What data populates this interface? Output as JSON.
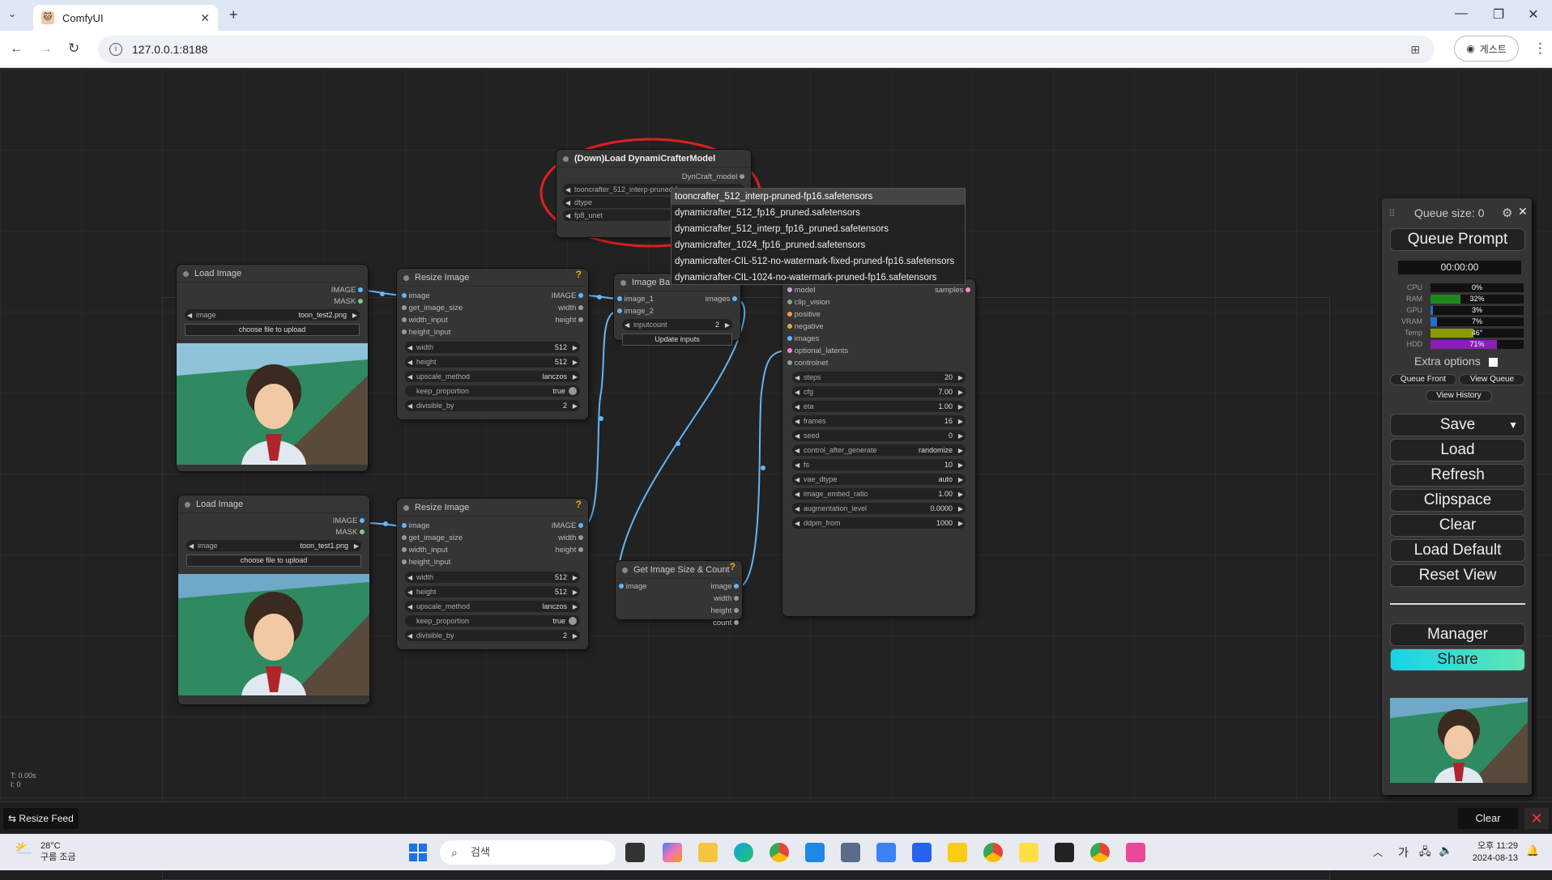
{
  "browser": {
    "tab_title": "ComfyUI",
    "url": "127.0.0.1:8188",
    "profile_label": "게스트"
  },
  "nodes": {
    "dyn_loader": {
      "title": "(Down)Load DynamiCrafterModel",
      "output": "DynCraft_model",
      "model_value": "tooncrafter_512_interp-pruned-f",
      "dtype_label": "dtype",
      "fp8_label": "fp8_unet"
    },
    "load_image_1": {
      "title": "Load Image",
      "out_image": "IMAGE",
      "out_mask": "MASK",
      "widget_label": "image",
      "widget_value": "toon_test2.png",
      "upload": "choose file to upload"
    },
    "load_image_2": {
      "title": "Load Image",
      "out_image": "IMAGE",
      "out_mask": "MASK",
      "widget_label": "image",
      "widget_value": "toon_test1.png",
      "upload": "choose file to upload"
    },
    "resize_1": {
      "title": "Resize Image",
      "inputs": [
        "image",
        "get_image_size",
        "width_input",
        "height_input"
      ],
      "outputs": [
        "IMAGE",
        "width",
        "height"
      ],
      "widgets": [
        {
          "label": "width",
          "value": "512"
        },
        {
          "label": "height",
          "value": "512"
        },
        {
          "label": "upscale_method",
          "value": "lanczos"
        },
        {
          "label": "keep_proportion",
          "value": "true"
        },
        {
          "label": "divisible_by",
          "value": "2"
        }
      ]
    },
    "resize_2": {
      "title": "Resize Image",
      "inputs": [
        "image",
        "get_image_size",
        "width_input",
        "height_input"
      ],
      "outputs": [
        "IMAGE",
        "width",
        "height"
      ],
      "widgets": [
        {
          "label": "width",
          "value": "512"
        },
        {
          "label": "height",
          "value": "512"
        },
        {
          "label": "upscale_method",
          "value": "lanczos"
        },
        {
          "label": "keep_proportion",
          "value": "true"
        },
        {
          "label": "divisible_by",
          "value": "2"
        }
      ]
    },
    "image_batch": {
      "title": "Image Ba",
      "inputs": [
        "image_1",
        "image_2"
      ],
      "output": "images",
      "widget_label": "inputcount",
      "widget_value": "2",
      "button": "Update inputs"
    },
    "get_size": {
      "title": "Get Image Size & Count",
      "input": "image",
      "outputs": [
        "image",
        "width",
        "height",
        "count"
      ]
    },
    "interp": {
      "inputs": [
        "model",
        "clip_vision",
        "positive",
        "negative",
        "images",
        "optional_latents",
        "controlnet"
      ],
      "output": "samples",
      "widgets": [
        {
          "label": "steps",
          "value": "20"
        },
        {
          "label": "cfg",
          "value": "7.00"
        },
        {
          "label": "eta",
          "value": "1.00"
        },
        {
          "label": "frames",
          "value": "16"
        },
        {
          "label": "seed",
          "value": "0"
        },
        {
          "label": "control_after_generate",
          "value": "randomize"
        },
        {
          "label": "fs",
          "value": "10"
        },
        {
          "label": "vae_dtype",
          "value": "auto"
        },
        {
          "label": "image_embed_ratio",
          "value": "1.00"
        },
        {
          "label": "augmentation_level",
          "value": "0.0000"
        },
        {
          "label": "ddpm_from",
          "value": "1000"
        }
      ]
    }
  },
  "dropdown": {
    "options": [
      "tooncrafter_512_interp-pruned-fp16.safetensors",
      "dynamicrafter_512_fp16_pruned.safetensors",
      "dynamicrafter_512_interp_fp16_pruned.safetensors",
      "dynamicrafter_1024_fp16_pruned.safetensors",
      "dynamicrafter-CIL-512-no-watermark-fixed-pruned-fp16.safetensors",
      "dynamicrafter-CIL-1024-no-watermark-pruned-fp16.safetensors"
    ]
  },
  "queue_panel": {
    "queue_size": "Queue size: 0",
    "queue_prompt": "Queue Prompt",
    "timer": "00:00:00",
    "stats": [
      {
        "label": "CPU",
        "value": "0%",
        "fraction": 0.0,
        "color": "#2e7d32"
      },
      {
        "label": "RAM",
        "value": "32%",
        "fraction": 0.32,
        "color": "#1b8a1b"
      },
      {
        "label": "GPU",
        "value": "3%",
        "fraction": 0.03,
        "color": "#1e6fd9"
      },
      {
        "label": "VRAM",
        "value": "7%",
        "fraction": 0.07,
        "color": "#1e6fd9"
      },
      {
        "label": "Temp",
        "value": "46°",
        "fraction": 0.46,
        "color": "#8a9a00"
      },
      {
        "label": "HDD",
        "value": "71%",
        "fraction": 0.71,
        "color": "#8a1fb5"
      }
    ],
    "extra_options": "Extra options",
    "queue_front": "Queue Front",
    "view_queue": "View Queue",
    "view_history": "View History",
    "buttons": {
      "save": "Save",
      "load": "Load",
      "refresh": "Refresh",
      "clipspace": "Clipspace",
      "clear": "Clear",
      "load_default": "Load Default",
      "reset_view": "Reset View",
      "manager": "Manager",
      "share": "Share"
    }
  },
  "canvas_info": {
    "line1": "T: 0.00s",
    "line2": "I: 0"
  },
  "bottom": {
    "resize_feed": "Resize Feed",
    "clear": "Clear"
  },
  "taskbar": {
    "weather_temp": "28°C",
    "weather_desc": "구름 조금",
    "search_placeholder": "검색",
    "ime": "가",
    "time": "오후 11:29",
    "date": "2024-08-13"
  },
  "colors": {
    "link": "#64b5f6",
    "annotation": "#e02020",
    "canvas": "#222222"
  }
}
